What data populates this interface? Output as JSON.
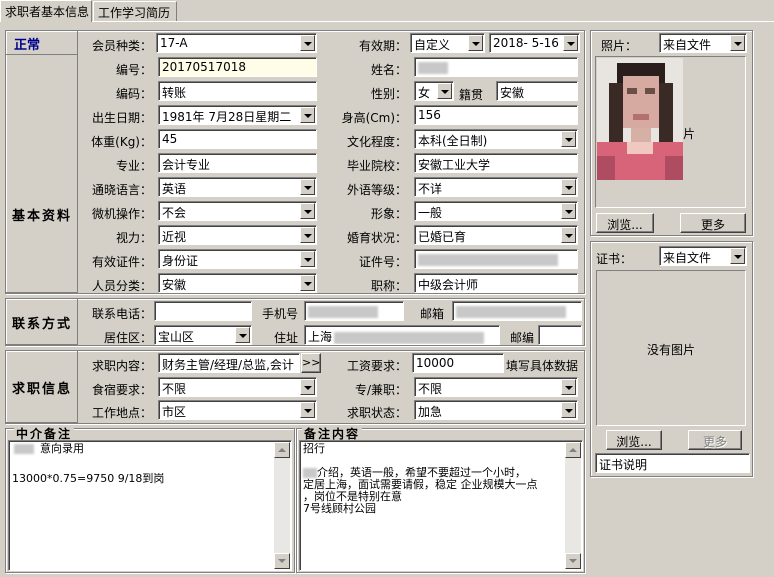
{
  "tabs": [
    "求职者基本信息",
    "工作学习简历"
  ],
  "status_text": "正常",
  "sections": {
    "basic": "基本资料",
    "contact": "联系方式",
    "job": "求职信息"
  },
  "colors": {
    "status": "#00008b",
    "field_yellow": "#fffde8",
    "window": "#d4d0c8"
  },
  "membership": {
    "label": "会员种类：",
    "value": "17-A"
  },
  "validity": {
    "label": "有效期：",
    "type": "自定义",
    "date": "2018- 5-16"
  },
  "basic": {
    "number": {
      "label": "编号：",
      "value": "20170517018"
    },
    "name": {
      "label": "姓名："
    },
    "code": {
      "label": "编码：",
      "value": "转账"
    },
    "gender": {
      "label": "性别：",
      "value": "女"
    },
    "native": {
      "label": "籍贯",
      "value": "安徽"
    },
    "birth": {
      "label": "出生日期：",
      "value": "1981年 7月28日星期二"
    },
    "height": {
      "label": "身高(Cm)：",
      "value": "156"
    },
    "weight": {
      "label": "体重(Kg)：",
      "value": "45"
    },
    "education": {
      "label": "文化程度：",
      "value": "本科(全日制)"
    },
    "major": {
      "label": "专业：",
      "value": "会计专业"
    },
    "school": {
      "label": "毕业院校：",
      "value": "安徽工业大学"
    },
    "language": {
      "label": "通晓语言：",
      "value": "英语"
    },
    "lang_level": {
      "label": "外语等级：",
      "value": "不详"
    },
    "computer": {
      "label": "微机操作：",
      "value": "不会"
    },
    "image": {
      "label": "形象：",
      "value": "一般"
    },
    "vision": {
      "label": "视力：",
      "value": "近视"
    },
    "marital": {
      "label": "婚育状况：",
      "value": "已婚已育"
    },
    "id_type": {
      "label": "有效证件：",
      "value": "身份证"
    },
    "id_no": {
      "label": "证件号："
    },
    "category": {
      "label": "人员分类：",
      "value": "安徽"
    },
    "title": {
      "label": "职称：",
      "value": "中级会计师"
    }
  },
  "contact": {
    "phone": {
      "label": "联系电话：",
      "value": ""
    },
    "mobile": {
      "label": "手机号"
    },
    "email": {
      "label": "邮箱"
    },
    "district": {
      "label": "居住区：",
      "value": "宝山区"
    },
    "address": {
      "label": "住址",
      "value": "上海"
    },
    "postcode": {
      "label": "邮编",
      "value": ""
    }
  },
  "job": {
    "content": {
      "label": "求职内容：",
      "value": "财务主管/经理/总监,会计",
      "more": ">>"
    },
    "salary": {
      "label": "工资要求：",
      "value": "10000",
      "hint": "填写具体数据"
    },
    "board": {
      "label": "食宿要求：",
      "value": "不限"
    },
    "fulltime": {
      "label": "专/兼职：",
      "value": "不限"
    },
    "location": {
      "label": "工作地点：",
      "value": "市区"
    },
    "status": {
      "label": "求职状态：",
      "value": "加急"
    }
  },
  "agent_notes": {
    "title": "中介备注",
    "lines": [
      "意向录用",
      "",
      "13000*0.75=9750 9/18到岗"
    ]
  },
  "remarks": {
    "title": "备注内容",
    "lines": [
      "招行",
      "",
      "",
      "介绍，英语一般，希望不要超过一个小时，",
      "定居上海，面试需要请假，稳定 企业规模大一点",
      "，岗位不是特别在意",
      "7号线顾村公园"
    ]
  },
  "photo": {
    "label": "照片：",
    "source": "来自文件",
    "caption_char": "片",
    "browse": "浏览...",
    "more": "更多"
  },
  "certificate": {
    "label": "证书：",
    "source": "来自文件",
    "empty_text": "没有图片",
    "browse": "浏览...",
    "more": "更多",
    "note": "证书说明"
  }
}
